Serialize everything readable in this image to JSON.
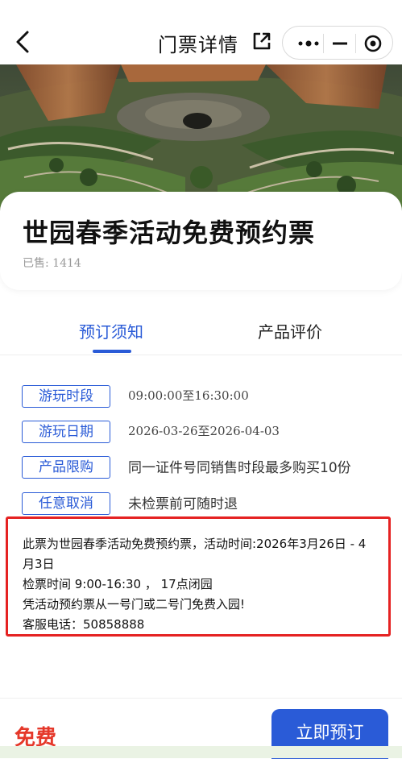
{
  "nav": {
    "title": "门票详情"
  },
  "ticket": {
    "title": "世园春季活动免费预约票",
    "sold_label": "已售:",
    "sold_count": "1414"
  },
  "tabs": [
    {
      "label": "预订须知"
    },
    {
      "label": "产品评价"
    }
  ],
  "info_rows": [
    {
      "tag": "游玩时段",
      "value": "09:00:00至16:30:00"
    },
    {
      "tag": "游玩日期",
      "value": "2026-03-26至2026-04-03"
    },
    {
      "tag": "产品限购",
      "value": "同一证件号同销售时段最多购买10份"
    },
    {
      "tag": "任意取消",
      "value": "未检票前可随时退"
    }
  ],
  "note": {
    "lines": [
      "此票为世园春季活动免费预约票，活动时间:2026年3月26日 - 4",
      "月3日",
      "检票时间 9:00-16:30 ， 17点闭园",
      "凭活动预约票从一号门或二号门免费入园!",
      "客服电话：50858888"
    ]
  },
  "bottom": {
    "price": "免费",
    "book_label": "立即预订"
  },
  "colors": {
    "accent": "#2a5bd7",
    "price": "#e5382a",
    "highlight_border": "#e52222"
  }
}
